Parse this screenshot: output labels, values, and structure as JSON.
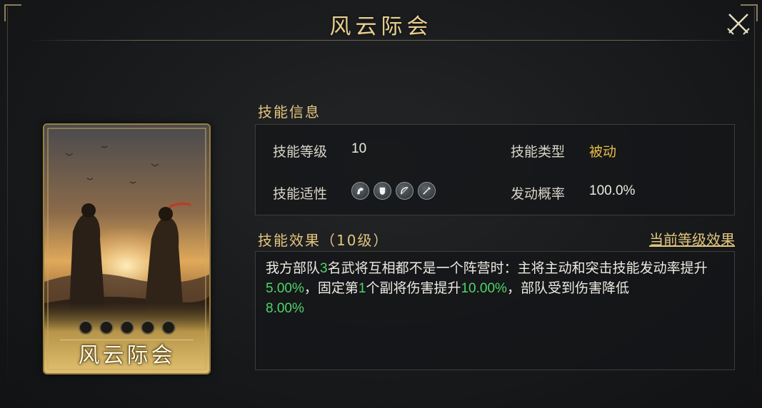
{
  "window": {
    "title": "风云际会"
  },
  "card": {
    "name": "风云际会",
    "star_slots": 5
  },
  "skill_info": {
    "section_title": "技能信息",
    "level_label": "技能等级",
    "level_value": "10",
    "type_label": "技能类型",
    "type_value": "被动",
    "suitability_label": "技能适性",
    "suitability_icons": [
      "cavalry-icon",
      "shield-icon",
      "bow-icon",
      "spear-icon"
    ],
    "trigger_label": "发动概率",
    "trigger_value": "100.0%"
  },
  "skill_effect": {
    "section_title": "技能效果（10级）",
    "current_level_link": "当前等级效果",
    "desc": {
      "p1": "我方部队",
      "n1": "3",
      "p2": "名武将互相都不是一个阵营时：主将主动和突击技能发动率提升",
      "n2": "5.00%",
      "p3": "，固定第",
      "n3": "1",
      "p4": "个副将伤害提升",
      "n4": "10.00%",
      "p5": "，部队受到伤害降低",
      "n5": "8.00%"
    }
  },
  "colors": {
    "title_gold": "#e9cf8f",
    "value_gold": "#e8bb4a",
    "highlight_green": "#4fd56a"
  }
}
